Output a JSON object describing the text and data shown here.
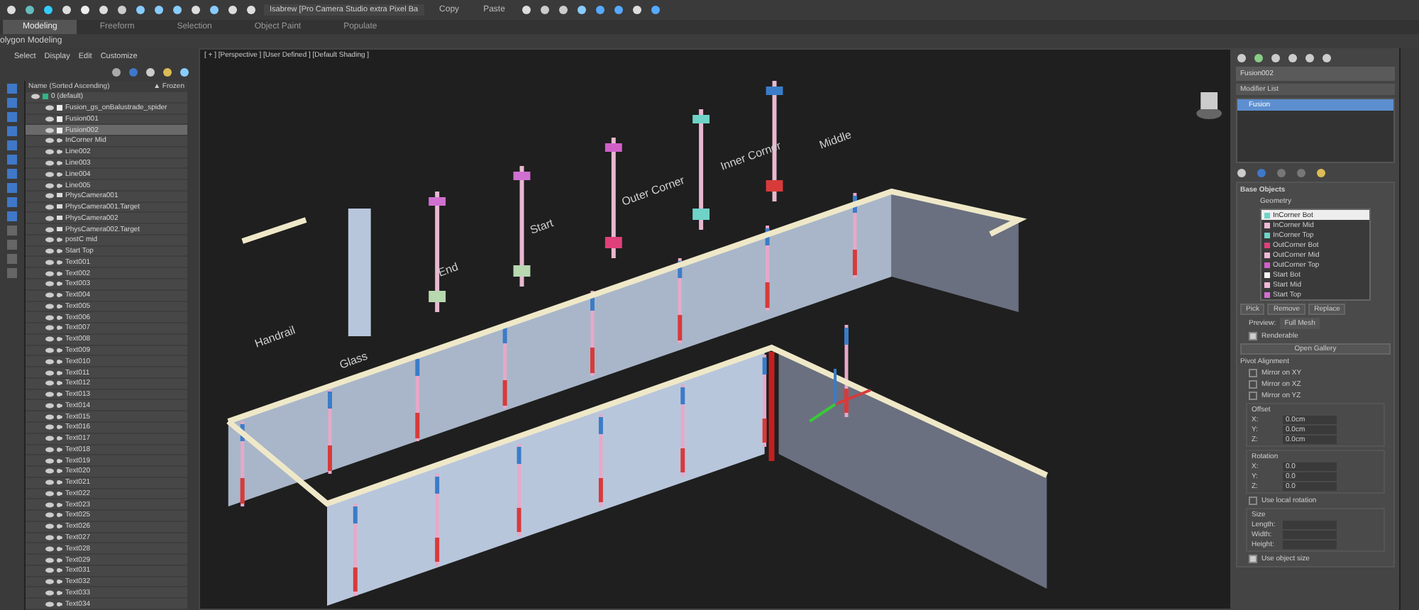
{
  "toolbar": {
    "workspace": "Isabrew [Pro Camera Studio extra Pixel Ba",
    "buttons": [
      "Copy",
      "Paste"
    ]
  },
  "ribbon": {
    "tabs": [
      {
        "label": "Modeling",
        "selected": true
      },
      {
        "label": "Freeform",
        "selected": false
      },
      {
        "label": "Selection",
        "selected": false
      },
      {
        "label": "Object Paint",
        "selected": false
      },
      {
        "label": "Populate",
        "selected": false
      }
    ],
    "panel": "olygon Modeling"
  },
  "scene_explorer": {
    "menu": [
      "Select",
      "Display",
      "Edit",
      "Customize"
    ],
    "columns": [
      "Name (Sorted Ascending)",
      "▲ Frozen"
    ],
    "rows": [
      {
        "name": "0 (default)",
        "kind": "layer",
        "selected": false
      },
      {
        "name": "Fusion_gs_onBalustrade_spider",
        "kind": "object",
        "selected": false
      },
      {
        "name": "Fusion001",
        "kind": "object",
        "selected": false
      },
      {
        "name": "Fusion002",
        "kind": "object",
        "selected": true
      },
      {
        "name": "InCorner Mid",
        "kind": "shape",
        "selected": false
      },
      {
        "name": "Line002",
        "kind": "shape",
        "selected": false
      },
      {
        "name": "Line003",
        "kind": "shape",
        "selected": false
      },
      {
        "name": "Line004",
        "kind": "shape",
        "selected": false
      },
      {
        "name": "Line005",
        "kind": "shape",
        "selected": false
      },
      {
        "name": "PhysCamera001",
        "kind": "camera",
        "selected": false
      },
      {
        "name": "PhysCamera001.Target",
        "kind": "camera",
        "selected": false
      },
      {
        "name": "PhysCamera002",
        "kind": "camera",
        "selected": false
      },
      {
        "name": "PhysCamera002.Target",
        "kind": "camera",
        "selected": false
      },
      {
        "name": "postC mid",
        "kind": "shape",
        "selected": false
      },
      {
        "name": "Start Top",
        "kind": "shape",
        "selected": false
      },
      {
        "name": "Text001",
        "kind": "shape",
        "selected": false
      },
      {
        "name": "Text002",
        "kind": "shape",
        "selected": false
      },
      {
        "name": "Text003",
        "kind": "shape",
        "selected": false
      },
      {
        "name": "Text004",
        "kind": "shape",
        "selected": false
      },
      {
        "name": "Text005",
        "kind": "shape",
        "selected": false
      },
      {
        "name": "Text006",
        "kind": "shape",
        "selected": false
      },
      {
        "name": "Text007",
        "kind": "shape",
        "selected": false
      },
      {
        "name": "Text008",
        "kind": "shape",
        "selected": false
      },
      {
        "name": "Text009",
        "kind": "shape",
        "selected": false
      },
      {
        "name": "Text010",
        "kind": "shape",
        "selected": false
      },
      {
        "name": "Text011",
        "kind": "shape",
        "selected": false
      },
      {
        "name": "Text012",
        "kind": "shape",
        "selected": false
      },
      {
        "name": "Text013",
        "kind": "shape",
        "selected": false
      },
      {
        "name": "Text014",
        "kind": "shape",
        "selected": false
      },
      {
        "name": "Text015",
        "kind": "shape",
        "selected": false
      },
      {
        "name": "Text016",
        "kind": "shape",
        "selected": false
      },
      {
        "name": "Text017",
        "kind": "shape",
        "selected": false
      },
      {
        "name": "Text018",
        "kind": "shape",
        "selected": false
      },
      {
        "name": "Text019",
        "kind": "shape",
        "selected": false
      },
      {
        "name": "Text020",
        "kind": "shape",
        "selected": false
      },
      {
        "name": "Text021",
        "kind": "shape",
        "selected": false
      },
      {
        "name": "Text022",
        "kind": "shape",
        "selected": false
      },
      {
        "name": "Text023",
        "kind": "shape",
        "selected": false
      },
      {
        "name": "Text025",
        "kind": "shape",
        "selected": false
      },
      {
        "name": "Text026",
        "kind": "shape",
        "selected": false
      },
      {
        "name": "Text027",
        "kind": "shape",
        "selected": false
      },
      {
        "name": "Text028",
        "kind": "shape",
        "selected": false
      },
      {
        "name": "Text029",
        "kind": "shape",
        "selected": false
      },
      {
        "name": "Text031",
        "kind": "shape",
        "selected": false
      },
      {
        "name": "Text032",
        "kind": "shape",
        "selected": false
      },
      {
        "name": "Text033",
        "kind": "shape",
        "selected": false
      },
      {
        "name": "Text034",
        "kind": "shape",
        "selected": false
      }
    ]
  },
  "viewport": {
    "label": "[ + ] [Perspective ] [User Defined ] [Default Shading ]",
    "part_labels": [
      "Handrail",
      "Glass",
      "End",
      "Start",
      "Outer Corner",
      "Inner Corner",
      "Middle"
    ]
  },
  "command_panel": {
    "object_name": "Fusion002",
    "modifier_list": "Modifier List",
    "stack": [
      {
        "label": "Fusion",
        "selected": true
      }
    ],
    "rollout": "Base Objects",
    "geometry_label": "Geometry",
    "geometry": [
      {
        "name": "InCorner Bot",
        "color": "#6fd3c8",
        "selected": true
      },
      {
        "name": "InCorner Mid",
        "color": "#f0b8d8",
        "selected": false
      },
      {
        "name": "InCorner Top",
        "color": "#6fd3c8",
        "selected": false
      },
      {
        "name": "OutCorner Bot",
        "color": "#e0407a",
        "selected": false
      },
      {
        "name": "OutCorner Mid",
        "color": "#f0b8d8",
        "selected": false
      },
      {
        "name": "OutCorner Top",
        "color": "#d060c8",
        "selected": false
      },
      {
        "name": "Start Bot",
        "color": "#f4f4f4",
        "selected": false
      },
      {
        "name": "Start Mid",
        "color": "#f0b8d8",
        "selected": false
      },
      {
        "name": "Start Top",
        "color": "#d070d0",
        "selected": false
      }
    ],
    "list_buttons": [
      "Pick",
      "Remove",
      "Replace"
    ],
    "preview_label": "Preview:",
    "preview_value": "Full Mesh",
    "renderable": {
      "label": "Renderable",
      "checked": true
    },
    "gallery_button": "Open Gallery",
    "pivot_label": "Pivot Alignment",
    "mirrors": [
      {
        "label": "Mirror on XY",
        "checked": false
      },
      {
        "label": "Mirror on XZ",
        "checked": false
      },
      {
        "label": "Mirror on YZ",
        "checked": false
      }
    ],
    "offset": {
      "title": "Offset",
      "fields": [
        {
          "axis": "X:",
          "value": "0.0cm"
        },
        {
          "axis": "Y:",
          "value": "0.0cm"
        },
        {
          "axis": "Z:",
          "value": "0.0cm"
        }
      ]
    },
    "rotation": {
      "title": "Rotation",
      "fields": [
        {
          "axis": "X:",
          "value": "0.0"
        },
        {
          "axis": "Y:",
          "value": "0.0"
        },
        {
          "axis": "Z:",
          "value": "0.0"
        }
      ]
    },
    "local_rotation": {
      "label": "Use local rotation",
      "checked": false
    },
    "size": {
      "title": "Size",
      "fields": [
        {
          "axis": "Length:"
        },
        {
          "axis": "Width:"
        },
        {
          "axis": "Height:"
        }
      ]
    },
    "object_size": {
      "label": "Use object size",
      "checked": true
    }
  }
}
